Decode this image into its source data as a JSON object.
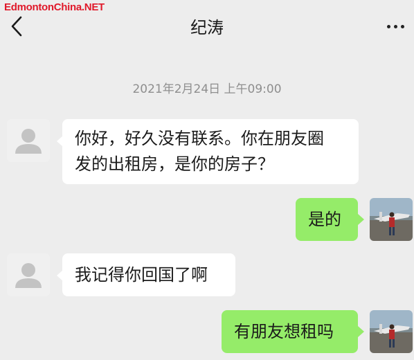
{
  "watermark": "EdmontonChina.NET",
  "header": {
    "title": "纪涛",
    "back_icon": "chevron-left-icon",
    "more_icon": "more-dots-icon"
  },
  "timestamp": "2021年2月24日 上午09:00",
  "colors": {
    "background": "#ededed",
    "incoming_bubble": "#ffffff",
    "outgoing_bubble": "#95ec69",
    "watermark": "#e0192a"
  },
  "messages": [
    {
      "side": "incoming",
      "text": "你好，好久没有联系。你在朋友圈\n发的出租房，是你的房子？"
    },
    {
      "side": "outgoing",
      "text": "是的"
    },
    {
      "side": "incoming",
      "text": "我记得你回国了啊"
    },
    {
      "side": "outgoing",
      "text": "有朋友想租吗"
    }
  ]
}
